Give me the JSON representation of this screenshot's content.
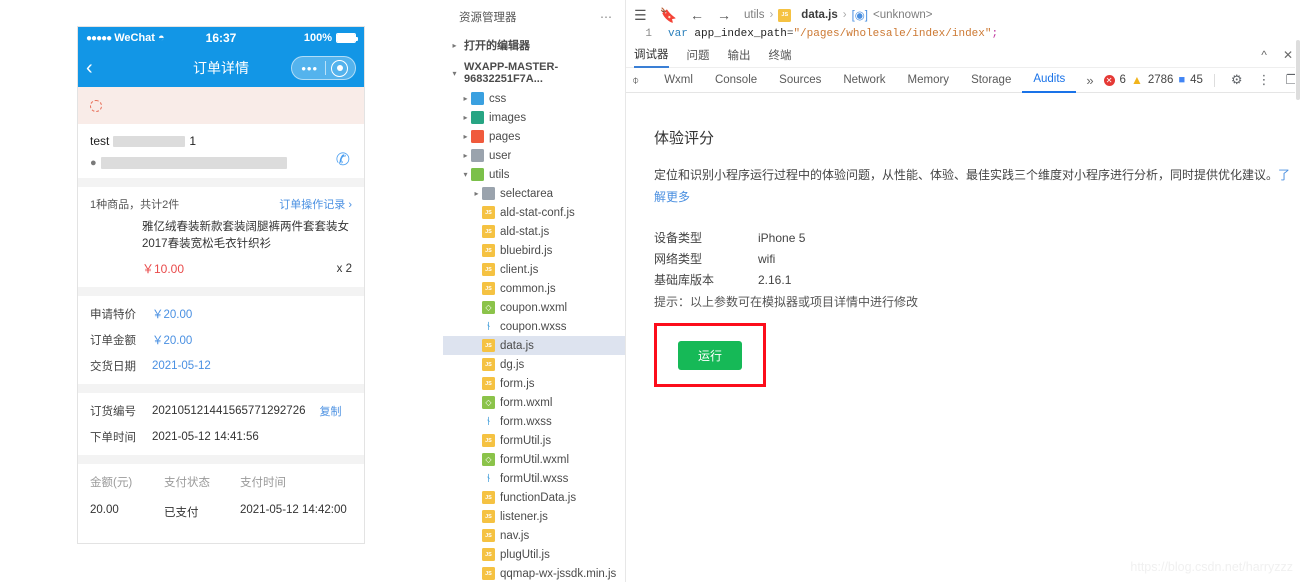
{
  "phone": {
    "status_bar": {
      "signal_dots": "●●●●●",
      "carrier": "WeChat",
      "wifi_icon": "wifi-icon",
      "time": "16:37",
      "battery_pct": "100%"
    },
    "nav": {
      "back_icon": "chevron-left-icon",
      "title": "订单详情",
      "capsule_more": "•••",
      "capsule_target": "target-icon"
    },
    "notice": {
      "icon": "refresh-circle-icon"
    },
    "address": {
      "name": "test",
      "name_suffix": "1",
      "pin_icon": "location-pin-icon",
      "call_icon": "phone-icon"
    },
    "goods": {
      "summary": "1种商品，共计2件",
      "op_link": "订单操作记录",
      "op_link_arrow": "›",
      "title": "雅亿绒春装新款套装阔腿裤两件套套装女2017春装宽松毛衣针织衫",
      "price": "￥10.00",
      "qty": "x 2"
    },
    "amounts": [
      {
        "k": "申请特价",
        "v": "￥20.00"
      },
      {
        "k": "订单金额",
        "v": "￥20.00"
      },
      {
        "k": "交货日期",
        "v": "2021-05-12"
      }
    ],
    "order_meta": [
      {
        "k": "订货编号",
        "v": "20210512144156577129​2726",
        "extra": "复制"
      },
      {
        "k": "下单时间",
        "v": "2021-05-12 14:41:56",
        "extra": ""
      }
    ],
    "pay_table": {
      "headers": [
        "金额(元)",
        "支付状态",
        "支付时间"
      ],
      "row": [
        "20.00",
        "已支付",
        "2021-05-12 14:42:00"
      ]
    }
  },
  "explorer": {
    "title": "资源管理器",
    "more_icon": "ellipsis-icon",
    "open_editors": "打开的编辑器",
    "project": "WXAPP-MASTER-96832251F7A...",
    "folders": [
      {
        "name": "css",
        "color": "#3aa0e0",
        "indent": 1
      },
      {
        "name": "images",
        "color": "#27a583",
        "indent": 1
      },
      {
        "name": "pages",
        "color": "#f05a3c",
        "indent": 1
      },
      {
        "name": "user",
        "color": "#9aa3ad",
        "indent": 1
      },
      {
        "name": "utils",
        "color": "#7bc04a",
        "indent": 1,
        "expanded": true
      },
      {
        "name": "selectarea",
        "color": "#9aa3ad",
        "indent": 2
      }
    ],
    "files": [
      {
        "name": "ald-stat-conf.js",
        "type": "js"
      },
      {
        "name": "ald-stat.js",
        "type": "js"
      },
      {
        "name": "bluebird.js",
        "type": "js"
      },
      {
        "name": "client.js",
        "type": "js"
      },
      {
        "name": "common.js",
        "type": "js"
      },
      {
        "name": "coupon.wxml",
        "type": "wxml"
      },
      {
        "name": "coupon.wxss",
        "type": "wxss"
      },
      {
        "name": "data.js",
        "type": "js",
        "selected": true
      },
      {
        "name": "dg.js",
        "type": "js"
      },
      {
        "name": "form.js",
        "type": "js"
      },
      {
        "name": "form.wxml",
        "type": "wxml"
      },
      {
        "name": "form.wxss",
        "type": "wxss"
      },
      {
        "name": "formUtil.js",
        "type": "js"
      },
      {
        "name": "formUtil.wxml",
        "type": "wxml"
      },
      {
        "name": "formUtil.wxss",
        "type": "wxss"
      },
      {
        "name": "functionData.js",
        "type": "js"
      },
      {
        "name": "listener.js",
        "type": "js"
      },
      {
        "name": "nav.js",
        "type": "js"
      },
      {
        "name": "plugUtil.js",
        "type": "js"
      },
      {
        "name": "qqmap-wx-jssdk.min.js",
        "type": "js"
      }
    ]
  },
  "editor": {
    "menu_icon": "hamburger-menu-icon",
    "bookmark_icon": "bookmark-icon",
    "back_icon": "arrow-left-icon",
    "forward_icon": "arrow-right-icon",
    "breadcrumb": {
      "folder": "utils",
      "file": "data.js",
      "symbol": "<unknown>"
    },
    "line_number": "1",
    "code": {
      "kw": "var",
      "name": "app_index_path",
      "op": "=",
      "str": "\"/pages/wholesale/index/index\"",
      "semi": ";"
    }
  },
  "devtools": {
    "zh_tabs": [
      "调试器",
      "问题",
      "输出",
      "终端"
    ],
    "zh_active": "调试器",
    "collapse_icon": "chevron-up-icon",
    "close_icon": "close-icon",
    "inspect_icon": "inspect-element-icon",
    "tabs": [
      "Wxml",
      "Console",
      "Sources",
      "Network",
      "Memory",
      "Storage",
      "Audits"
    ],
    "active_tab": "Audits",
    "more_tabs_icon": "»",
    "counts": {
      "errors": "6",
      "warnings": "2786",
      "messages": "45"
    },
    "settings_icon": "gear-icon",
    "kebab_icon": "more-vertical-icon",
    "dock_icon": "dock-panel-icon"
  },
  "audits": {
    "heading": "体验评分",
    "description": "定位和识别小程序运行过程中的体验问题，从性能、体验、最佳实践三个维度对小程序进行分析，同时提供优化建议。",
    "link_text": "了解更多",
    "params": [
      {
        "k": "设备类型",
        "v": "iPhone 5"
      },
      {
        "k": "网络类型",
        "v": "wifi"
      },
      {
        "k": "基础库版本",
        "v": "2.16.1"
      }
    ],
    "tip": "提示：以上参数可在模拟器或项目详情中进行修改",
    "run_button": "运行"
  },
  "watermark": "https://blog.csdn.net/harryzzz"
}
